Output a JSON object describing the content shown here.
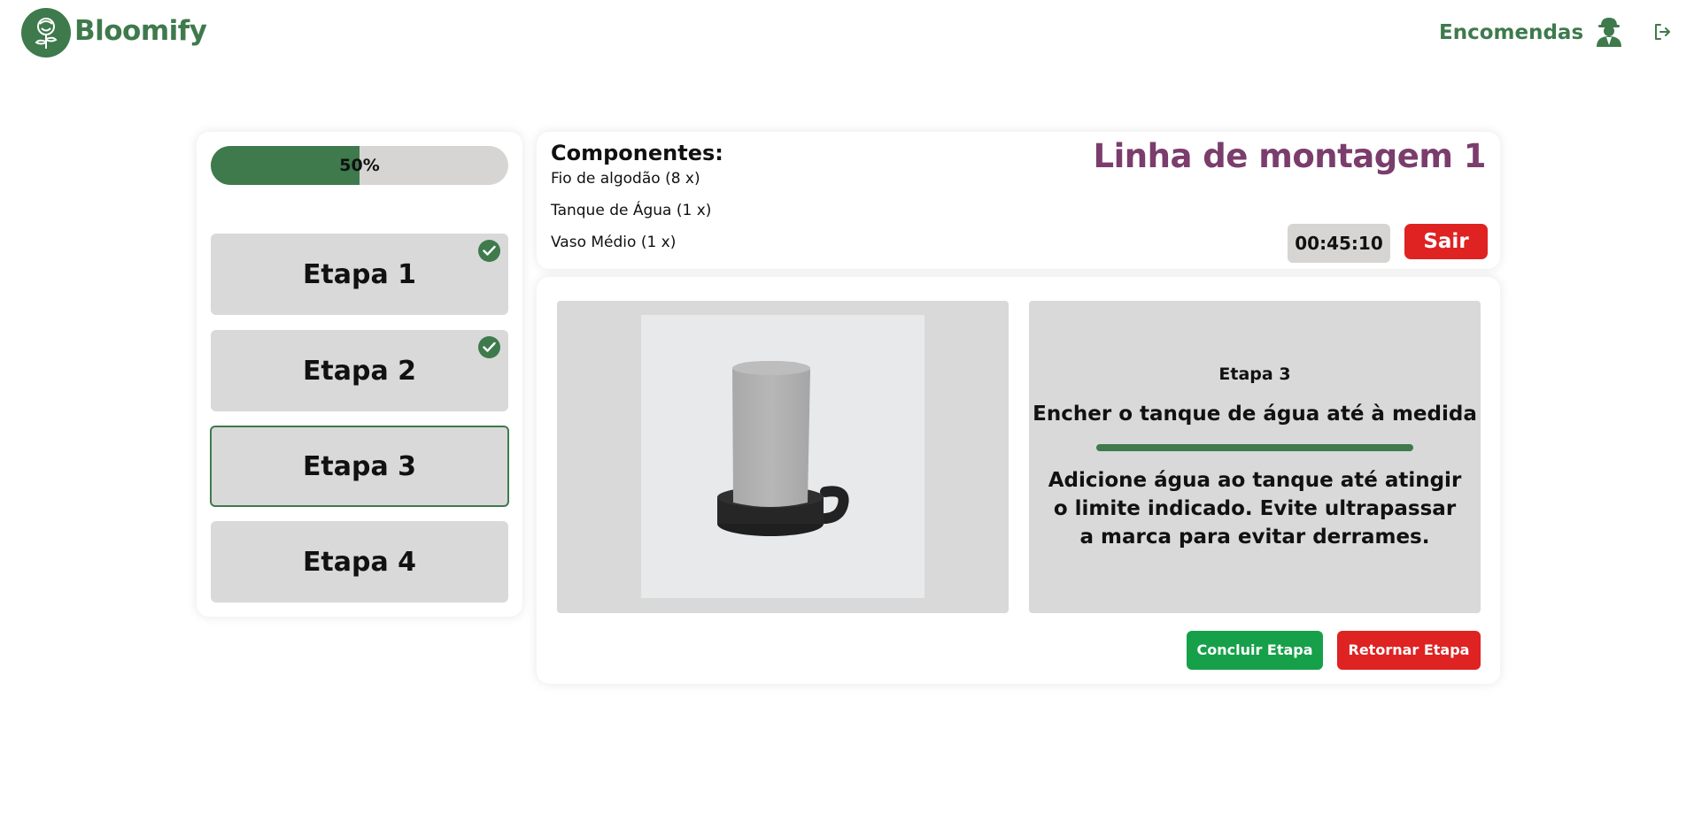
{
  "header": {
    "brand": "Bloomify",
    "nav_orders": "Encomendas"
  },
  "colors": {
    "primary_green": "#3e7a4c",
    "line_title_purple": "#7a3d6c",
    "danger_red": "#df2222",
    "success_green": "#17a04a"
  },
  "progress": {
    "value": 0.5,
    "label": "50%"
  },
  "steps": [
    {
      "label": "Etapa 1",
      "completed": true,
      "active": false
    },
    {
      "label": "Etapa 2",
      "completed": true,
      "active": false
    },
    {
      "label": "Etapa 3",
      "completed": false,
      "active": true
    },
    {
      "label": "Etapa 4",
      "completed": false,
      "active": false
    }
  ],
  "components": {
    "title": "Componentes:",
    "items": [
      "Fio de algodão (8 x)",
      "Tanque de Água (1 x)",
      "Vaso Médio (1 x)"
    ]
  },
  "line_title": "Linha de montagem 1",
  "timer": "00:45:10",
  "exit_label": "Sair",
  "current_step": {
    "heading": "Etapa 3",
    "subtitle": "Encher o tanque de água até à medida",
    "description": "Adicione água ao tanque até atingir o limite indicado. Evite ultrapassar a marca para evitar derrames."
  },
  "actions": {
    "finish_label": "Concluir Etapa",
    "back_label": "Retornar Etapa"
  },
  "icons": {
    "logo": "rose-logo-icon",
    "worker": "worker-icon",
    "logout": "logout-icon",
    "check": "check-circle-icon"
  }
}
